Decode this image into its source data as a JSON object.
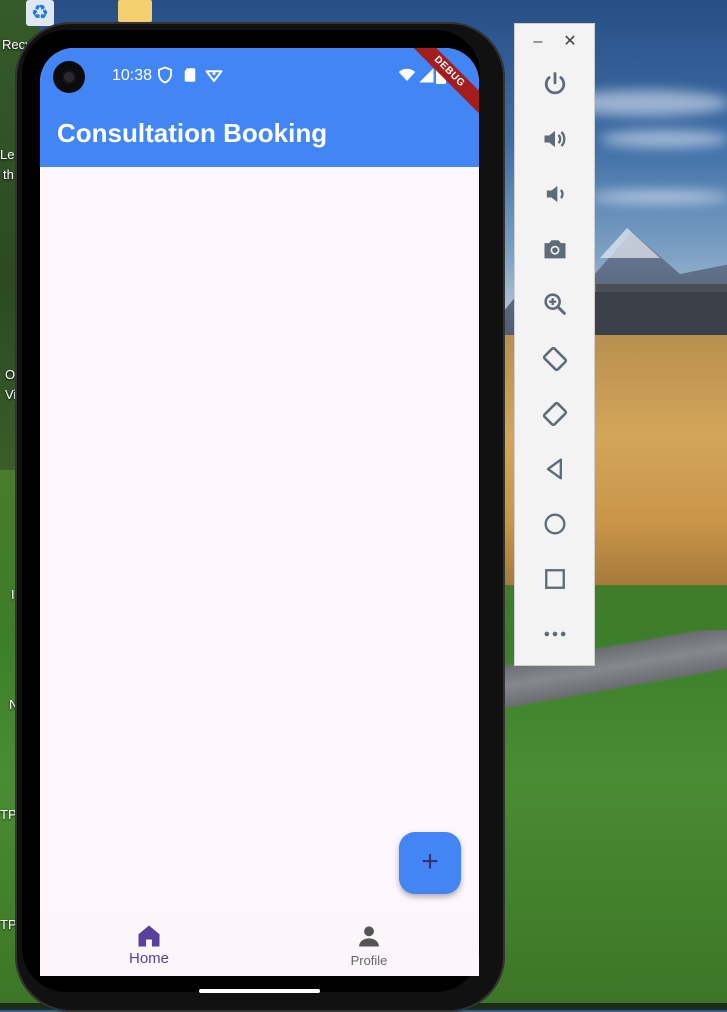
{
  "desktop": {
    "labels": {
      "recycle": "Recy",
      "le": "Le",
      "th": "th",
      "o": "O",
      "vi": "Vi",
      "i": "I",
      "n": "N",
      "tp1": "TP",
      "tp2": "TP"
    }
  },
  "phone": {
    "status_bar": {
      "time": "10:38"
    },
    "debug_banner": "DEBUG",
    "app_bar": {
      "title": "Consultation Booking",
      "color": "#4285f4"
    },
    "fab": {
      "icon": "add-icon",
      "label": "+"
    },
    "bottom_nav": {
      "items": [
        {
          "label": "Home",
          "icon": "home-icon",
          "selected": true
        },
        {
          "label": "Profile",
          "icon": "person-icon",
          "selected": false
        }
      ],
      "selected_color": "#5a3f9c",
      "unselected_color": "#555555"
    }
  },
  "emulator_toolbar": {
    "window_controls": {
      "minimize": "–",
      "close": "✕"
    },
    "buttons": [
      {
        "name": "power-icon",
        "title": "Power"
      },
      {
        "name": "volume-up-icon",
        "title": "Volume up"
      },
      {
        "name": "volume-down-icon",
        "title": "Volume down"
      },
      {
        "name": "camera-icon",
        "title": "Take screenshot"
      },
      {
        "name": "zoom-icon",
        "title": "Zoom"
      },
      {
        "name": "rotate-left-icon",
        "title": "Rotate left"
      },
      {
        "name": "rotate-right-icon",
        "title": "Rotate right"
      },
      {
        "name": "back-icon",
        "title": "Back"
      },
      {
        "name": "home-circle-icon",
        "title": "Home"
      },
      {
        "name": "overview-icon",
        "title": "Overview"
      },
      {
        "name": "more-icon",
        "title": "More"
      }
    ]
  }
}
